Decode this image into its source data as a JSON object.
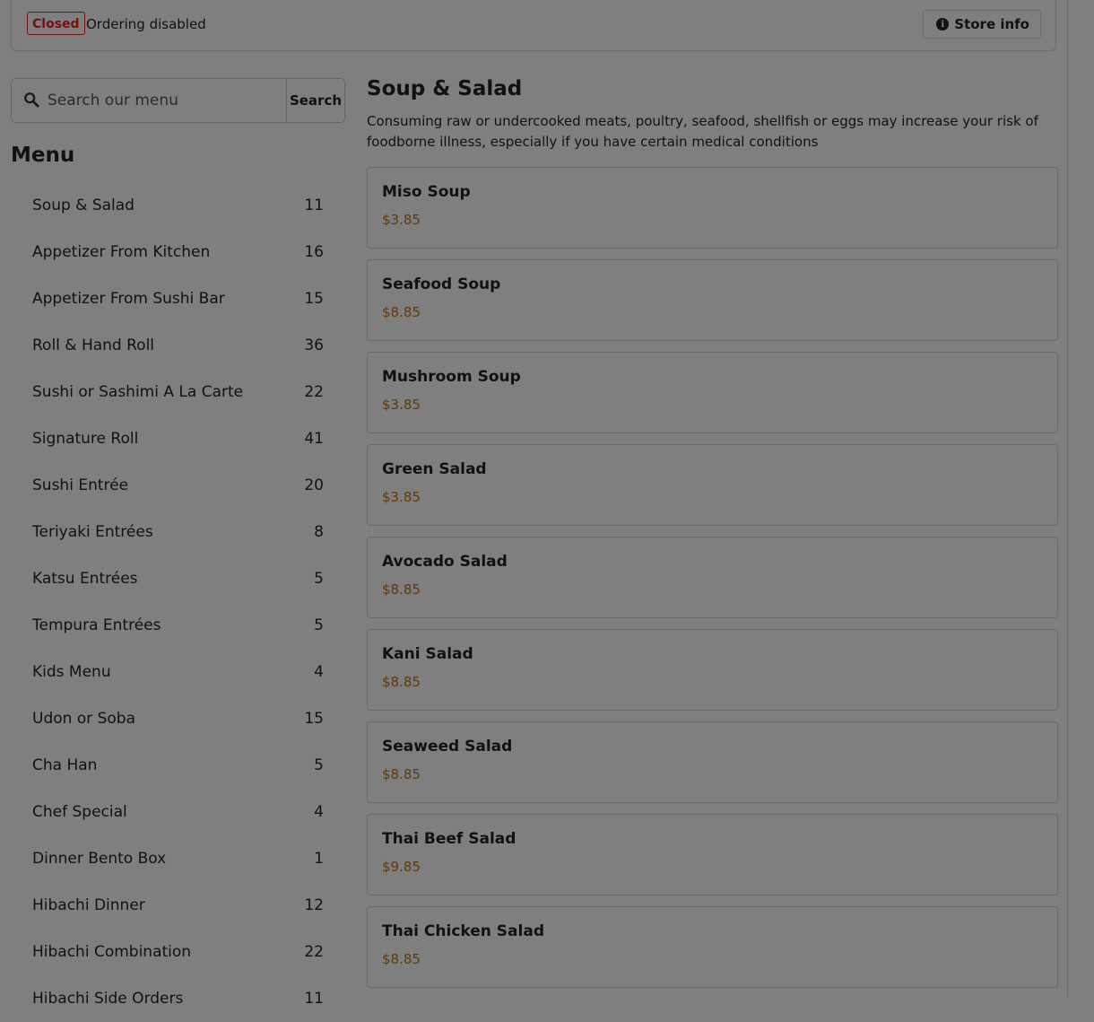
{
  "status": {
    "badge": "Closed",
    "ordering": "Ordering disabled",
    "store_info_label": "Store info",
    "badge_color": "#7a0d0d"
  },
  "search": {
    "placeholder": "Search our menu",
    "button_label": "Search"
  },
  "menu": {
    "heading": "Menu",
    "categories": [
      {
        "label": "Soup & Salad",
        "count": "11"
      },
      {
        "label": "Appetizer From Kitchen",
        "count": "16"
      },
      {
        "label": "Appetizer From Sushi Bar",
        "count": "15"
      },
      {
        "label": "Roll & Hand Roll",
        "count": "36"
      },
      {
        "label": "Sushi or Sashimi A La Carte",
        "count": "22"
      },
      {
        "label": "Signature Roll",
        "count": "41"
      },
      {
        "label": "Sushi Entrée",
        "count": "20"
      },
      {
        "label": "Teriyaki Entrées",
        "count": "8"
      },
      {
        "label": "Katsu Entrées",
        "count": "5"
      },
      {
        "label": "Tempura Entrées",
        "count": "5"
      },
      {
        "label": "Kids Menu",
        "count": "4"
      },
      {
        "label": "Udon or Soba",
        "count": "15"
      },
      {
        "label": "Cha Han",
        "count": "5"
      },
      {
        "label": "Chef Special",
        "count": "4"
      },
      {
        "label": "Dinner Bento Box",
        "count": "1"
      },
      {
        "label": "Hibachi Dinner",
        "count": "12"
      },
      {
        "label": "Hibachi Combination",
        "count": "22"
      },
      {
        "label": "Hibachi Side Orders",
        "count": "11"
      }
    ]
  },
  "content": {
    "title": "Soup & Salad",
    "disclaimer": "Consuming raw or undercooked meats, poultry, seafood, shellfish or eggs may increase your risk of foodborne illness, especially if you have certain medical conditions",
    "items": [
      {
        "name": "Miso Soup",
        "price": "$3.85"
      },
      {
        "name": "Seafood Soup",
        "price": "$8.85"
      },
      {
        "name": "Mushroom Soup",
        "price": "$3.85"
      },
      {
        "name": "Green Salad",
        "price": "$3.85"
      },
      {
        "name": "Avocado Salad",
        "price": "$8.85"
      },
      {
        "name": "Kani Salad",
        "price": "$8.85"
      },
      {
        "name": "Seaweed Salad",
        "price": "$8.85"
      },
      {
        "name": "Thai Beef Salad",
        "price": "$9.85"
      },
      {
        "name": "Thai Chicken Salad",
        "price": "$8.85"
      }
    ]
  },
  "icons": {
    "info": "info-circle-icon",
    "search": "search-icon"
  },
  "colors": {
    "overlay_bg": "#7f7f7f",
    "price": "#5f3a09"
  }
}
